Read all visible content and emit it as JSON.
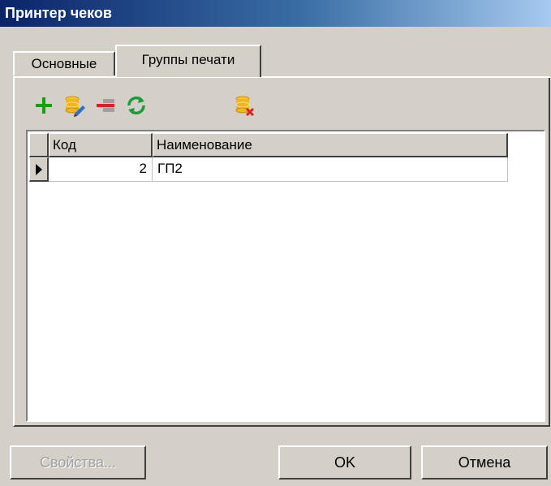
{
  "window": {
    "title": "Принтер чеков"
  },
  "tabs": [
    {
      "label": "Основные",
      "active": false
    },
    {
      "label": "Группы печати",
      "active": true
    }
  ],
  "toolbar": {
    "icons": [
      "add-icon",
      "edit-icon",
      "remove-icon",
      "refresh-icon",
      "clear-icon"
    ]
  },
  "table": {
    "columns": [
      "Код",
      "Наименование"
    ],
    "rows": [
      {
        "code": "2",
        "name": "ГП2",
        "current": true
      }
    ]
  },
  "buttons": {
    "properties": "Свойства...",
    "ok": "OK",
    "cancel": "Отмена"
  },
  "colors": {
    "title_gradient_start": "#0a246a",
    "title_gradient_end": "#a6caf0",
    "dialog_face": "#d4d0c8",
    "add_icon": "#14a014",
    "refresh_icon": "#1a9c3a",
    "delete_mark": "#e02020"
  }
}
